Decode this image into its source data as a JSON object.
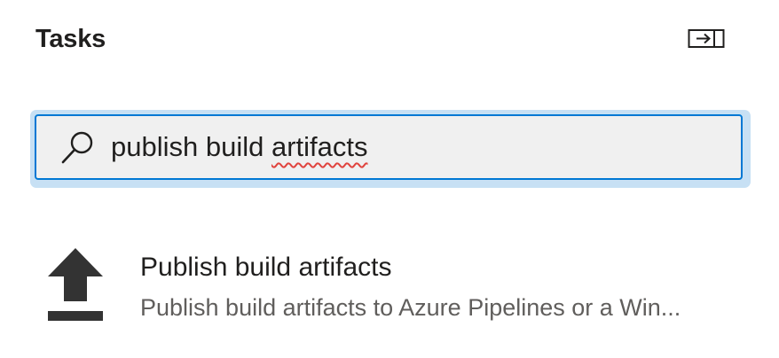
{
  "panel": {
    "title": "Tasks"
  },
  "icons": {
    "collapse": "collapse-panel-icon",
    "search": "search-icon",
    "task": "upload-icon"
  },
  "search": {
    "value_prefix": "publish build ",
    "value_misspelled": "artifacts"
  },
  "tasks": [
    {
      "name": "Publish build artifacts",
      "description": "Publish build artifacts to Azure Pipelines or a Win..."
    }
  ],
  "colors": {
    "accent": "#0078d4",
    "focus_halo": "#c7e0f4",
    "input_background": "#f0f0f0",
    "spellcheck": "#e0443e",
    "secondary_text": "#605e5c"
  }
}
